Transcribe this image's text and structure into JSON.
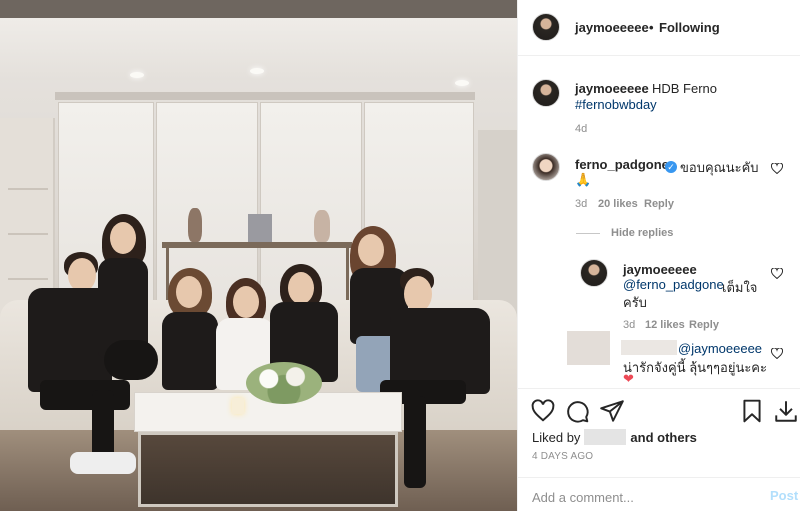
{
  "header": {
    "username": "jaymoeeeee",
    "separator": "•",
    "follow_status": "Following"
  },
  "caption": {
    "username": "jaymoeeeee",
    "text": "HDB Ferno",
    "hashtag": "#fernobwbday",
    "time": "4d"
  },
  "comments": [
    {
      "username": "ferno_padgone",
      "verified_icon": "verified-badge-icon",
      "text": "ขอบคุณนะคับ",
      "text_line2": "🙏",
      "time": "3d",
      "likes": "20 likes",
      "reply_label": "Reply",
      "hide_replies_label": "Hide replies"
    },
    {
      "username": "jaymoeeeee",
      "mention": "@ferno_padgone",
      "text": "เต็มใจ",
      "text_line2": "ครับ",
      "time": "3d",
      "likes": "12 likes",
      "reply_label": "Reply"
    },
    {
      "mention": "@jaymoeeeee",
      "text": "น่ารักจังคู่นี้ ลุ้นๆๆอยู่นะคะ",
      "emoji": "❤"
    }
  ],
  "actions": {
    "liked_by_prefix": "Liked by",
    "liked_by_suffix": "and others",
    "time_ago": "4 DAYS AGO",
    "comment_placeholder": "Add a comment...",
    "post_label": "Post",
    "icons": [
      "heart-icon",
      "comment-icon",
      "share-icon",
      "bookmark-icon",
      "download-icon"
    ]
  },
  "colors": {
    "link": "#00376b",
    "muted": "#8e8e8e",
    "verified": "#3897f0",
    "post_disabled": "#b2dffc",
    "heart_red": "#ed4956"
  }
}
